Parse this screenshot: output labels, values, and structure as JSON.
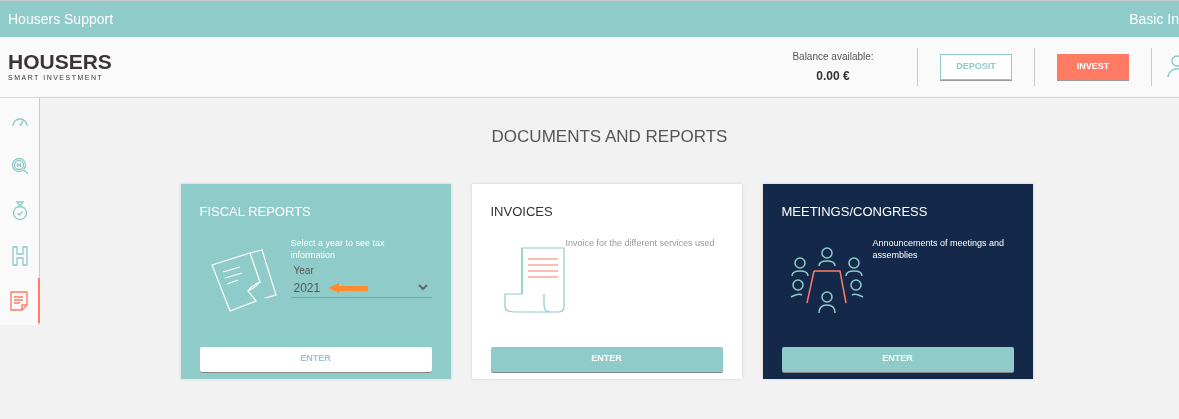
{
  "top_bar": {
    "title": "Housers Support",
    "right_text": "Basic In"
  },
  "header": {
    "logo": {
      "name": "HOUSERS",
      "tagline": "SMART INVESTMENT"
    },
    "balance_label": "Balance available:",
    "balance_value": "0.00 €",
    "buttons": [
      {
        "label": "DEPOSIT",
        "kind": "outline"
      },
      {
        "label": "INVEST",
        "kind": "primary"
      }
    ]
  },
  "sidebar": {
    "items": [
      {
        "kind": "gauge",
        "selected": false
      },
      {
        "kind": "search",
        "selected": false
      },
      {
        "kind": "stopwatch",
        "selected": false
      },
      {
        "kind": "h",
        "selected": false
      },
      {
        "kind": "document",
        "selected": true
      }
    ]
  },
  "page_title": "DOCUMENTS AND REPORTS",
  "cards": [
    {
      "kind": "fiscal",
      "title": "FISCAL REPORTS",
      "description": "Select a year to see tax information",
      "select": {
        "label": "Year",
        "value": "2021"
      },
      "button": "ENTER"
    },
    {
      "kind": "invoices",
      "title": "INVOICES",
      "description": "Invoice for the different services used",
      "button": "ENTER"
    },
    {
      "kind": "meetings",
      "title": "MEETINGS/CONGRESS",
      "description": "Announcements of meetings and assemblies",
      "button": "ENTER"
    }
  ]
}
